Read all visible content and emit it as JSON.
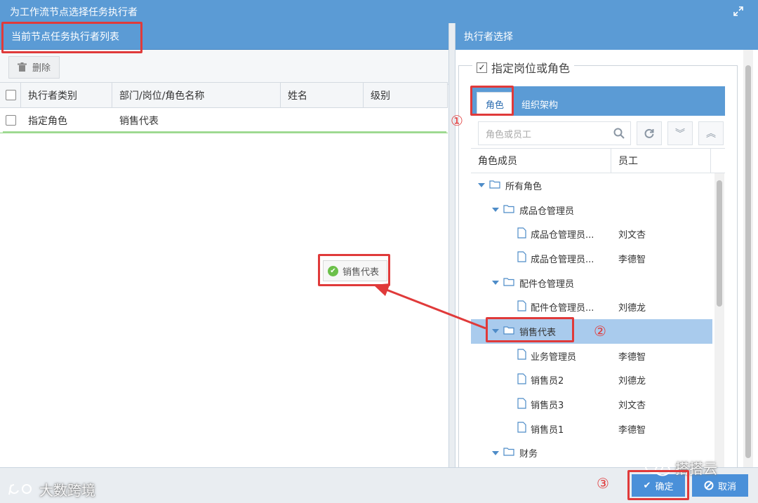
{
  "window": {
    "title": "为工作流节点选择任务执行者"
  },
  "left_panel": {
    "header": "当前节点任务执行者列表",
    "delete_label": "删除",
    "columns": [
      "执行者类别",
      "部门/岗位/角色名称",
      "姓名",
      "级别"
    ],
    "rows": [
      {
        "type": "指定角色",
        "name": "销售代表",
        "person": "",
        "level": ""
      }
    ],
    "drag_chip": "销售代表"
  },
  "right_panel": {
    "header": "执行者选择",
    "fieldset_legend": "指定岗位或角色",
    "tabs": [
      "角色",
      "组织架构"
    ],
    "active_tab": "角色",
    "search_placeholder": "角色或员工",
    "tree_columns": [
      "角色成员",
      "员工"
    ],
    "tree": [
      {
        "level": 0,
        "kind": "folder",
        "label": "所有角色",
        "employee": ""
      },
      {
        "level": 1,
        "kind": "folder",
        "label": "成品仓管理员",
        "employee": ""
      },
      {
        "level": 2,
        "kind": "file",
        "label": "成品仓管理员...",
        "employee": "刘文杏"
      },
      {
        "level": 2,
        "kind": "file",
        "label": "成品仓管理员...",
        "employee": "李德智"
      },
      {
        "level": 1,
        "kind": "folder",
        "label": "配件仓管理员",
        "employee": ""
      },
      {
        "level": 2,
        "kind": "file",
        "label": "配件仓管理员...",
        "employee": "刘德龙"
      },
      {
        "level": 1,
        "kind": "folder",
        "label": "销售代表",
        "employee": "",
        "selected": true
      },
      {
        "level": 2,
        "kind": "file",
        "label": "业务管理员",
        "employee": "李德智"
      },
      {
        "level": 2,
        "kind": "file",
        "label": "销售员2",
        "employee": "刘德龙"
      },
      {
        "level": 2,
        "kind": "file",
        "label": "销售员3",
        "employee": "刘文杏"
      },
      {
        "level": 2,
        "kind": "file",
        "label": "销售员1",
        "employee": "李德智"
      },
      {
        "level": 1,
        "kind": "folder",
        "label": "财务",
        "employee": ""
      }
    ]
  },
  "footer": {
    "ok_label": "确定",
    "cancel_label": "取消"
  },
  "annotations": [
    "①",
    "②",
    "③"
  ],
  "watermarks": {
    "left": "大数跨境",
    "right": "搭搭云"
  },
  "colors": {
    "header_blue": "#5b9bd5",
    "button_blue": "#4a90d9",
    "annotation_red": "#e03a3a",
    "selected_row": "#a9cbed"
  }
}
